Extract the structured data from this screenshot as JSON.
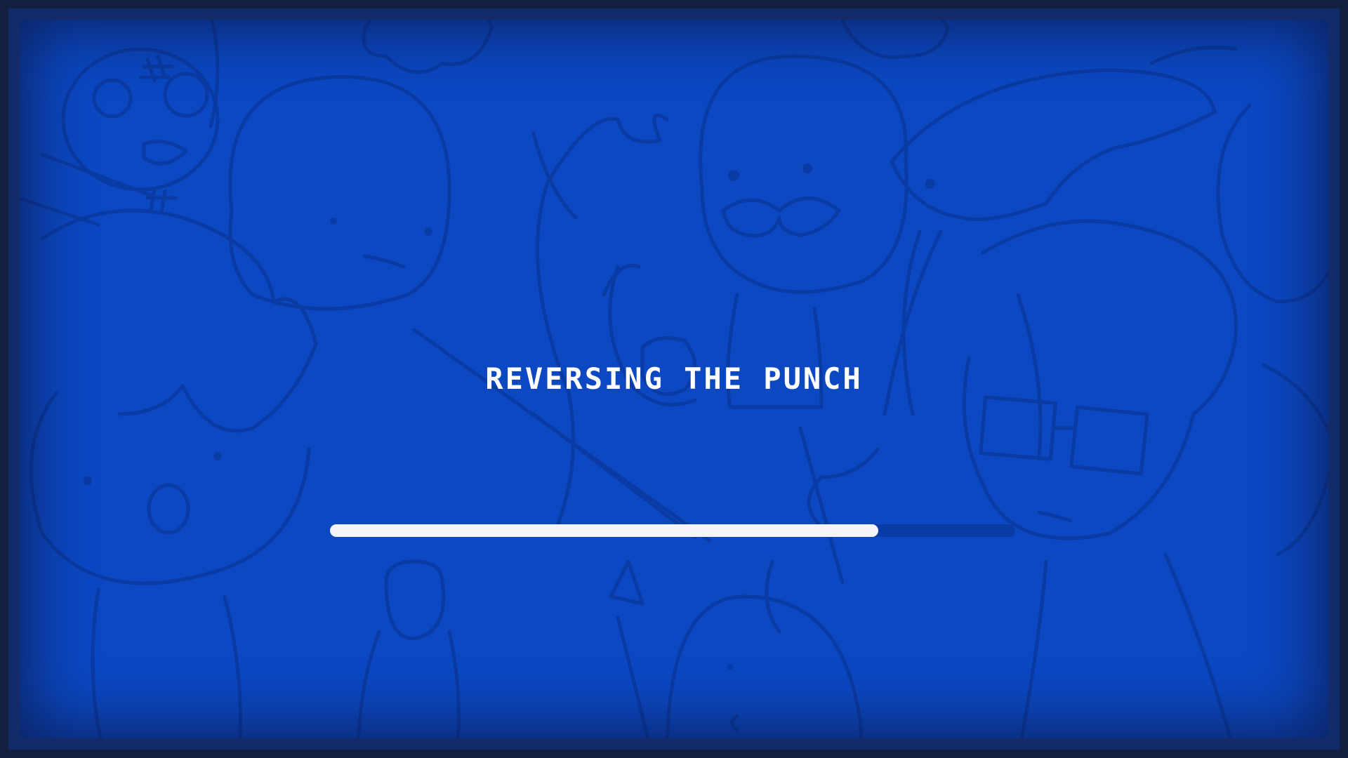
{
  "loading": {
    "status_text": "REVERSING THE PUNCH",
    "progress": 0.8
  },
  "colors": {
    "background": "#0b48c2",
    "doodle_lines": "#0a3aa3",
    "frame": "#13203f",
    "text": "#ffffff",
    "bar_fill": "#f3f5fa",
    "bar_track": "#0a3aa3"
  }
}
